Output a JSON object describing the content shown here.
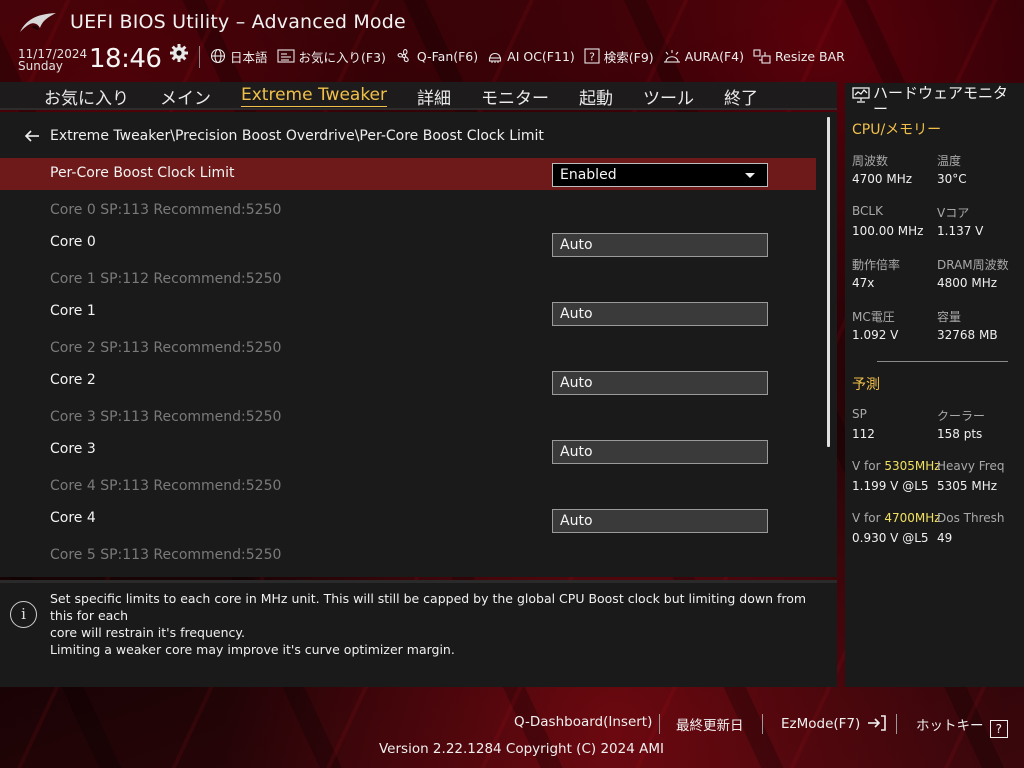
{
  "header": {
    "title": "UEFI BIOS Utility – Advanced Mode",
    "date": "11/17/2024",
    "day": "Sunday",
    "time": "18:46",
    "toolbar": [
      {
        "label": "日本語",
        "icon": "globe-icon"
      },
      {
        "label": "お気に入り(F3)",
        "icon": "favorites-icon"
      },
      {
        "label": "Q-Fan(F6)",
        "icon": "fan-icon"
      },
      {
        "label": "AI OC(F11)",
        "icon": "ai-chip-icon"
      },
      {
        "label": "検索(F9)",
        "icon": "search-help-icon"
      },
      {
        "label": "AURA(F4)",
        "icon": "aura-icon"
      },
      {
        "label": "Resize BAR",
        "icon": "resize-bar-icon"
      }
    ]
  },
  "tabs": [
    {
      "label": "お気に入り"
    },
    {
      "label": "メイン"
    },
    {
      "label": "Extreme Tweaker",
      "active": true
    },
    {
      "label": "詳細"
    },
    {
      "label": "モニター"
    },
    {
      "label": "起動"
    },
    {
      "label": "ツール"
    },
    {
      "label": "終了"
    }
  ],
  "breadcrumb": "Extreme Tweaker\\Precision Boost Overdrive\\Per-Core Boost Clock Limit",
  "settings": {
    "main": {
      "label": "Per-Core Boost Clock Limit",
      "value": "Enabled"
    },
    "cores": [
      {
        "info": "Core 0  SP:113  Recommend:5250",
        "label": "Core 0",
        "value": "Auto"
      },
      {
        "info": "Core 1  SP:112  Recommend:5250",
        "label": "Core 1",
        "value": "Auto"
      },
      {
        "info": "Core 2  SP:113  Recommend:5250",
        "label": "Core 2",
        "value": "Auto"
      },
      {
        "info": "Core 3  SP:113  Recommend:5250",
        "label": "Core 3",
        "value": "Auto"
      },
      {
        "info": "Core 4  SP:113  Recommend:5250",
        "label": "Core 4",
        "value": "Auto"
      },
      {
        "info": "Core 5  SP:113  Recommend:5250"
      }
    ]
  },
  "help": {
    "line1": "Set specific limits to each core in MHz unit. This will still be capped by the global CPU Boost clock but limiting down from this for each",
    "line2": "core will restrain it's frequency.",
    "line3": "Limiting a weaker core may improve it's curve optimizer margin."
  },
  "hwmon": {
    "title": "ハードウェアモニター",
    "cpu_section": "CPU/メモリー",
    "freq_k": "周波数",
    "freq_v": "4700 MHz",
    "temp_k": "温度",
    "temp_v": "30°C",
    "bclk_k": "BCLK",
    "bclk_v": "100.00 MHz",
    "vcore_k": "Vコア",
    "vcore_v": "1.137 V",
    "ratio_k": "動作倍率",
    "ratio_v": "47x",
    "dram_k": "DRAM周波数",
    "dram_v": "4800 MHz",
    "mcv_k": "MC電圧",
    "mcv_v": "1.092 V",
    "cap_k": "容量",
    "cap_v": "32768 MB",
    "predict_section": "予測",
    "sp_k": "SP",
    "sp_v": "112",
    "cooler_k": "クーラー",
    "cooler_v": "158 pts",
    "vfor1_prefix": "V for ",
    "vfor1_freq": "5305MHz",
    "vfor1_v": "1.199 V @L5",
    "heavy_k": "Heavy Freq",
    "heavy_v": "5305 MHz",
    "vfor2_prefix": "V for ",
    "vfor2_freq": "4700MHz",
    "vfor2_v": "0.930 V @L5",
    "dos_k": "Dos Thresh",
    "dos_v": "49"
  },
  "footer": {
    "qdashboard": "Q-Dashboard(Insert)",
    "last_modified": "最終更新日",
    "ezmode": "EzMode(F7)",
    "hotkeys": "ホットキー",
    "hotkey_symbol": "?",
    "version": "Version 2.22.1284 Copyright (C) 2024 AMI"
  },
  "colors": {
    "accent": "#f0c04a",
    "highlight_row": "#6e1a1a",
    "panel": "#1a1a1a"
  }
}
